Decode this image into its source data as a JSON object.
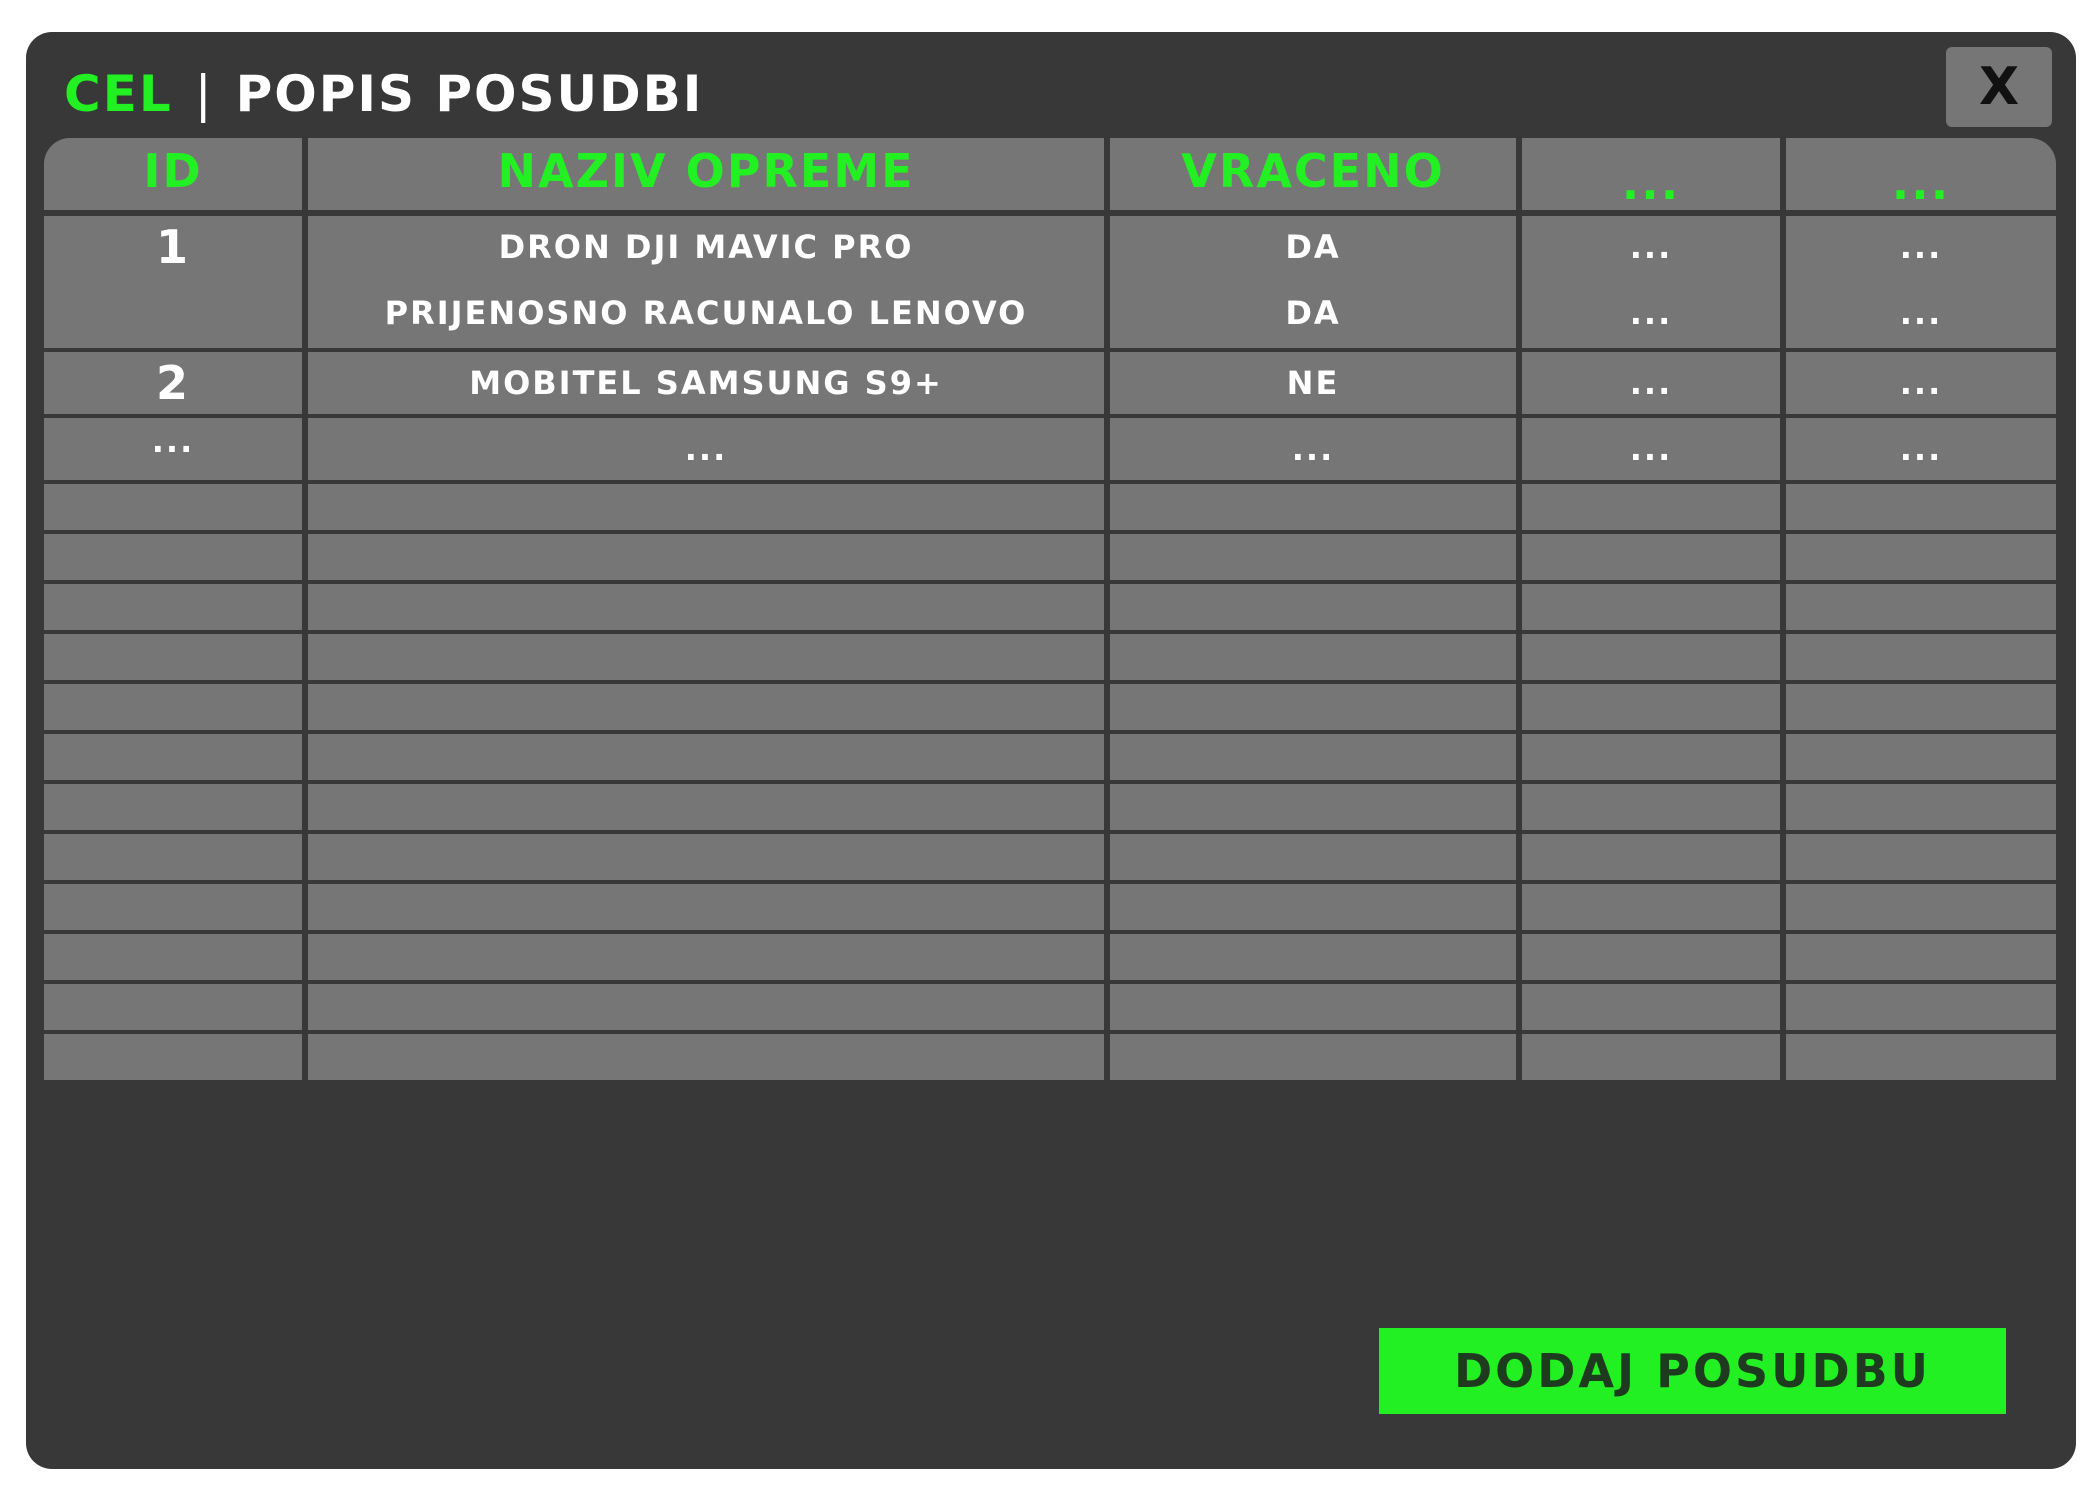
{
  "window": {
    "app_name": "CEL",
    "separator": "|",
    "page_title": "POPIS POSUDBI",
    "close_label": "X"
  },
  "table": {
    "headers": [
      "ID",
      "NAZIV OPREME",
      "VRACENO",
      "...",
      "..."
    ],
    "rows": [
      {
        "id": "1",
        "items": [
          "DRON DJI MAVIC PRO",
          "PRIJENOSNO RACUNALO LENOVO"
        ],
        "returned": [
          "DA",
          "DA"
        ],
        "c4": [
          "...",
          "..."
        ],
        "c5": [
          "...",
          "..."
        ]
      },
      {
        "id": "2",
        "items": [
          "MOBITEL SAMSUNG S9+"
        ],
        "returned": [
          "NE"
        ],
        "c4": [
          "..."
        ],
        "c5": [
          "..."
        ]
      },
      {
        "id": "...",
        "items": [
          "..."
        ],
        "returned": [
          "..."
        ],
        "c4": [
          "..."
        ],
        "c5": [
          "..."
        ]
      }
    ],
    "empty_rows": 12
  },
  "actions": {
    "add_label": "DODAJ POSUDBU"
  },
  "colors": {
    "accent": "#22f022",
    "window_bg": "#383838",
    "cell_bg": "#767676"
  }
}
